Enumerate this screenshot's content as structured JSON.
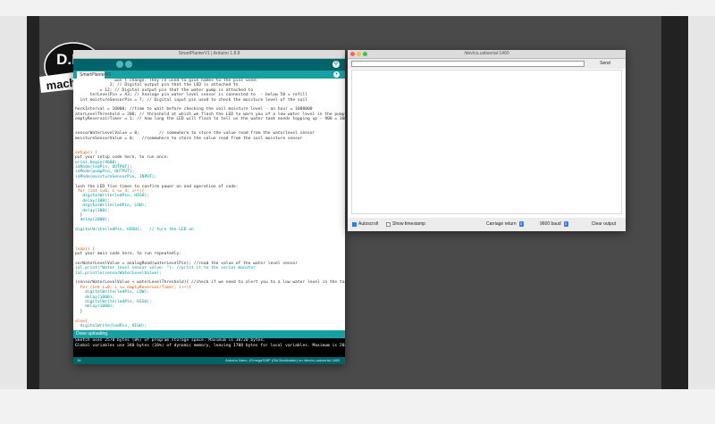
{
  "logo": {
    "line1": "D.I.Y",
    "line2": "machines"
  },
  "ide": {
    "title": "SmartPlanterV1 | Arduino 1.8.8",
    "tab_label": "SmartPlanterV1",
    "tab_menu_glyph": "▾",
    "serial_monitor_glyph": "⚲",
    "code_lines": [
      {
        "t": "                won't change. They're used to give names to the pins used:",
        "c": ""
      },
      {
        "t": "              2; // Digital output pin that the LED is attached to",
        "c": ""
      },
      {
        "t": "          = 12; // Digital output pin that the water pump is attached to",
        "c": ""
      },
      {
        "t": "      terLevelPin = A3; // Analoge pin water level sensor is connected to  - below 50 = refill",
        "c": ""
      },
      {
        "t": "  int moistureSensorPin = 7; // Digital input pin used to check the moisture level of the soil",
        "c": ""
      },
      {
        "t": "",
        "c": ""
      },
      {
        "t": "heckInterval = 10000; //time to wait before checking the soil moisture level - an hour = 1800000",
        "c": ""
      },
      {
        "t": "aterLevelThreshold = 200; // threshold at which we flash the LED to warn you of a low water level in the pump tank",
        "c": ""
      },
      {
        "t": "emptyReservoirTimer = 1; // how long the LED will flash to tell us the water tank needs topping up - 900 = 30mins",
        "c": ""
      },
      {
        "t": "",
        "c": ""
      },
      {
        "t": "",
        "c": ""
      },
      {
        "t": "sensorWaterLevelValue = 0;        // somewhere to store the value read from the waterlevel sensor",
        "c": ""
      },
      {
        "t": "moistureSensorValue = 0;   //somewhere to store the value read from the soil moisture sensor",
        "c": ""
      },
      {
        "t": "",
        "c": ""
      },
      {
        "t": "",
        "c": ""
      },
      {
        "t": "setup() {",
        "c": "kw"
      },
      {
        "t": "put your setup code here, to run once:",
        "c": ""
      },
      {
        "t": "erial.begin(9600);",
        "c": "fn"
      },
      {
        "t": "inMode(ledPin, OUTPUT);",
        "c": "fn"
      },
      {
        "t": "inMode(pumpPin, OUTPUT);",
        "c": "fn"
      },
      {
        "t": "inMode(moistureSensorPin, INPUT);",
        "c": "fn"
      },
      {
        "t": "",
        "c": ""
      },
      {
        "t": "lash the LED five times to confirm power on and operation of code:",
        "c": ""
      },
      {
        "t": " for (int i=0; i <= 4; i++){",
        "c": "kw"
      },
      {
        "t": "   digitalWrite(ledPin, HIGH);",
        "c": "fn"
      },
      {
        "t": "   delay(300);",
        "c": "fn"
      },
      {
        "t": "   digitalWrite(ledPin, LOW);",
        "c": "fn"
      },
      {
        "t": "   delay(300);",
        "c": "fn"
      },
      {
        "t": "  }",
        "c": ""
      },
      {
        "t": "  delay(2000);",
        "c": "fn"
      },
      {
        "t": "",
        "c": ""
      },
      {
        "t": "digitalWrite(ledPin, HIGH);   // turn the LED on",
        "c": "fn"
      },
      {
        "t": "",
        "c": ""
      },
      {
        "t": "",
        "c": ""
      },
      {
        "t": "",
        "c": ""
      },
      {
        "t": "loop() {",
        "c": "kw"
      },
      {
        "t": "put your main code here, to run repeatedly:",
        "c": ""
      },
      {
        "t": "",
        "c": ""
      },
      {
        "t": "sorWaterLevelValue = analogRead(waterLevelPin); //read the value of the water level sensor",
        "c": ""
      },
      {
        "t": "ial.print(\"Water level sensor value: \"); //print it to the serial monitor",
        "c": "fn"
      },
      {
        "t": "ial.println(sensorWaterLevelValue);",
        "c": "fn"
      },
      {
        "t": "",
        "c": ""
      },
      {
        "t": "(sensorWaterLevelValue < waterLevelThreshold){ //check if we need to alert you to a low water level in the tank",
        "c": ""
      },
      {
        "t": "  for (int i=0; i <= emptyReservoirTimer; i++){",
        "c": "kw"
      },
      {
        "t": "    digitalWrite(ledPin, LOW);",
        "c": "fn"
      },
      {
        "t": "    delay(1000);",
        "c": "fn"
      },
      {
        "t": "    digitalWrite(ledPin, HIGH);",
        "c": "fn"
      },
      {
        "t": "    delay(1000);",
        "c": "fn"
      },
      {
        "t": "  }",
        "c": ""
      },
      {
        "t": "",
        "c": ""
      },
      {
        "t": "else{",
        "c": "kw"
      },
      {
        "t": "  digitalWrite(ledPin, HIGH);",
        "c": "fn"
      }
    ],
    "status": "Done uploading.",
    "console_lines": [
      "Sketch uses 2578 bytes (8%) of program storage space. Maximum is 30720 bytes.",
      "Global variables use 340 bytes (16%) of dynamic memory, leaving 1708 bytes for local variables. Maximum is 2048 bytes."
    ],
    "line_number": "16",
    "board_info": "Arduino Nano, ATmega328P (Old Bootloader) on /dev/cu.usbserial-1460"
  },
  "serial": {
    "title": "/dev/cu.usbserial-1460",
    "input_value": "",
    "send_label": "Send",
    "autoscroll_label": "Autoscroll",
    "autoscroll_checked": true,
    "timestamp_label": "Show timestamp",
    "timestamp_checked": false,
    "line_ending": "Carriage return",
    "baud": "9600 baud",
    "clear_label": "Clear output"
  },
  "colors": {
    "arduino_teal_dark": "#006468",
    "arduino_teal": "#17a1a5",
    "desktop": "#4a4a4a"
  }
}
